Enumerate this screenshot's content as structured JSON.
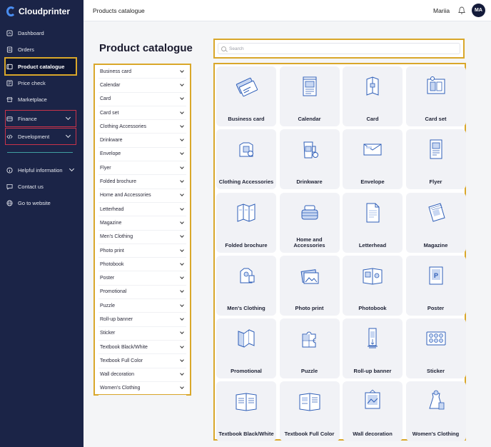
{
  "app": {
    "name": "Cloudprinter"
  },
  "sidebar": {
    "items": [
      {
        "label": "Dashboard",
        "icon": "dashboard-icon"
      },
      {
        "label": "Orders",
        "icon": "orders-icon"
      },
      {
        "label": "Product catalogue",
        "icon": "catalogue-icon"
      },
      {
        "label": "Price check",
        "icon": "price-check-icon"
      },
      {
        "label": "Marketplace",
        "icon": "marketplace-icon"
      },
      {
        "label": "Finance",
        "icon": "finance-icon"
      },
      {
        "label": "Development",
        "icon": "code-icon"
      },
      {
        "label": "Helpful information",
        "icon": "info-icon"
      },
      {
        "label": "Contact us",
        "icon": "chat-icon"
      },
      {
        "label": "Go to website",
        "icon": "globe-icon"
      }
    ]
  },
  "header": {
    "title": "Products catalogue",
    "user_name": "Mariia",
    "avatar_initials": "MA"
  },
  "main": {
    "page_title": "Product catalogue"
  },
  "search": {
    "placeholder": "Search"
  },
  "categories": [
    "Business card",
    "Calendar",
    "Card",
    "Card set",
    "Clothing Accessories",
    "Drinkware",
    "Envelope",
    "Flyer",
    "Folded brochure",
    "Home and Accessories",
    "Letterhead",
    "Magazine",
    "Men's Clothing",
    "Photo print",
    "Photobook",
    "Poster",
    "Promotional",
    "Puzzle",
    "Roll-up banner",
    "Sticker",
    "Textbook Black/White",
    "Textbook Full Color",
    "Wall decoration",
    "Women's Clothing"
  ],
  "products": [
    {
      "label": "Business card",
      "icon": "business-card-icon"
    },
    {
      "label": "Calendar",
      "icon": "calendar-icon"
    },
    {
      "label": "Card",
      "icon": "card-icon"
    },
    {
      "label": "Card set",
      "icon": "card-set-icon"
    },
    {
      "label": "Clothing Accessories",
      "icon": "clothing-accessories-icon"
    },
    {
      "label": "Drinkware",
      "icon": "drinkware-icon"
    },
    {
      "label": "Envelope",
      "icon": "envelope-icon"
    },
    {
      "label": "Flyer",
      "icon": "flyer-icon"
    },
    {
      "label": "Folded brochure",
      "icon": "folded-brochure-icon"
    },
    {
      "label": "Home and Accessories",
      "icon": "home-accessories-icon"
    },
    {
      "label": "Letterhead",
      "icon": "letterhead-icon"
    },
    {
      "label": "Magazine",
      "icon": "magazine-icon"
    },
    {
      "label": "Men's Clothing",
      "icon": "mens-clothing-icon"
    },
    {
      "label": "Photo print",
      "icon": "photo-print-icon"
    },
    {
      "label": "Photobook",
      "icon": "photobook-icon"
    },
    {
      "label": "Poster",
      "icon": "poster-icon"
    },
    {
      "label": "Promotional",
      "icon": "promotional-icon"
    },
    {
      "label": "Puzzle",
      "icon": "puzzle-icon"
    },
    {
      "label": "Roll-up banner",
      "icon": "rollup-banner-icon"
    },
    {
      "label": "Sticker",
      "icon": "sticker-icon"
    },
    {
      "label": "Textbook Black/White",
      "icon": "textbook-bw-icon"
    },
    {
      "label": "Textbook Full Color",
      "icon": "textbook-color-icon"
    },
    {
      "label": "Wall decoration",
      "icon": "wall-decoration-icon"
    },
    {
      "label": "Women's Clothing",
      "icon": "womens-clothing-icon"
    }
  ],
  "colors": {
    "sidebar_bg": "#1b2447",
    "highlight": "#d9a72a",
    "icon_blue": "#2f5fb8",
    "logo_blue": "#4a8df0"
  }
}
